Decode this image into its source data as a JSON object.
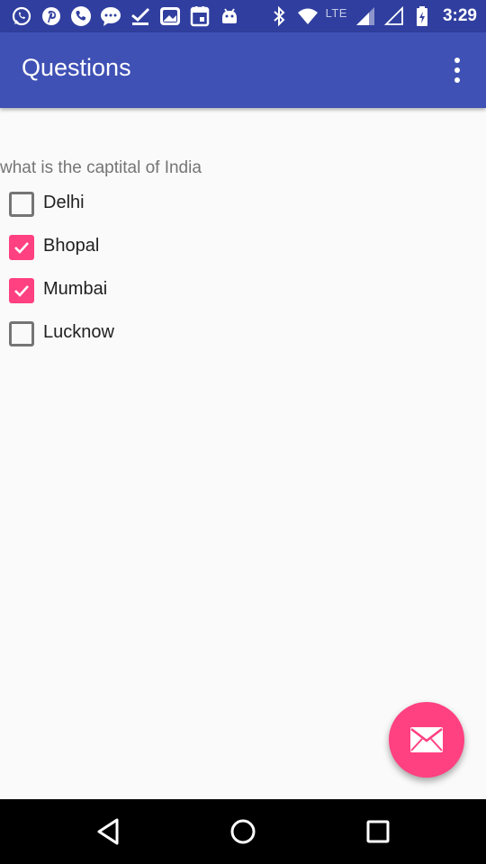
{
  "status_bar": {
    "left_icons": [
      "whatsapp-icon",
      "pinterest-icon",
      "phone-icon",
      "messenger-icon",
      "check-icon",
      "image-icon",
      "calendar-icon",
      "android-icon"
    ],
    "right_icons": [
      "bluetooth-icon",
      "wifi-icon",
      "signal-icon",
      "signal-empty-icon",
      "battery-icon"
    ],
    "network": "LTE",
    "time": "3:29"
  },
  "app_bar": {
    "title": "Questions",
    "overflow_icon": "more-vert-icon",
    "color": "#3f51b5"
  },
  "question": {
    "text": "what is the captital of India",
    "options": [
      {
        "label": "Delhi",
        "checked": false
      },
      {
        "label": "Bhopal",
        "checked": true
      },
      {
        "label": "Mumbai",
        "checked": true
      },
      {
        "label": "Lucknow",
        "checked": false
      }
    ]
  },
  "fab": {
    "icon": "email-icon",
    "color": "#ff4081"
  },
  "nav_bar": {
    "icons": [
      "back-icon",
      "home-icon",
      "recents-icon"
    ]
  }
}
